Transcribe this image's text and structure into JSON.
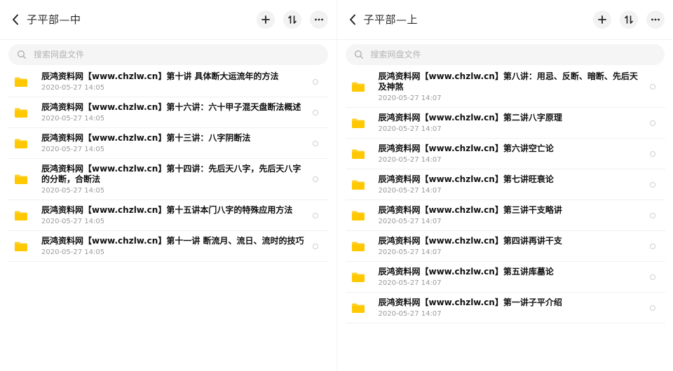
{
  "panes": [
    {
      "title": "子平部—中",
      "search_placeholder": "搜索网盘文件",
      "items": [
        {
          "name": "辰鸿资料网【www.chzlw.cn】第十讲 具体断大运流年的方法",
          "date": "2020-05-27  14:05"
        },
        {
          "name": "辰鸿资料网【www.chzlw.cn】第十六讲：六十甲子混天盘断法概述",
          "date": "2020-05-27  14:05"
        },
        {
          "name": "辰鸿资料网【www.chzlw.cn】第十三讲：八字阴断法",
          "date": "2020-05-27  14:05"
        },
        {
          "name": "辰鸿资料网【www.chzlw.cn】第十四讲：先后天八字，先后天八字的分断，合断法",
          "date": "2020-05-27  14:05"
        },
        {
          "name": "辰鸿资料网【www.chzlw.cn】第十五讲本门八字的特殊应用方法",
          "date": "2020-05-27  14:05"
        },
        {
          "name": "辰鸿资料网【www.chzlw.cn】第十一讲 断流月、流日、流时的技巧",
          "date": "2020-05-27  14:05"
        }
      ]
    },
    {
      "title": "子平部—上",
      "search_placeholder": "搜索网盘文件",
      "items": [
        {
          "name": "辰鸿资料网【www.chzlw.cn】第八讲：用忌、反断、暗断、先后天及神煞",
          "date": "2020-05-27  14:07"
        },
        {
          "name": "辰鸿资料网【www.chzlw.cn】第二讲八字原理",
          "date": "2020-05-27  14:07"
        },
        {
          "name": "辰鸿资料网【www.chzlw.cn】第六讲空亡论",
          "date": "2020-05-27  14:07"
        },
        {
          "name": "辰鸿资料网【www.chzlw.cn】第七讲旺衰论",
          "date": "2020-05-27  14:07"
        },
        {
          "name": "辰鸿资料网【www.chzlw.cn】第三讲干支略讲",
          "date": "2020-05-27  14:07"
        },
        {
          "name": "辰鸿资料网【www.chzlw.cn】第四讲再讲干支",
          "date": "2020-05-27  14:07"
        },
        {
          "name": "辰鸿资料网【www.chzlw.cn】第五讲库墓论",
          "date": "2020-05-27  14:07"
        },
        {
          "name": "辰鸿资料网【www.chzlw.cn】第一讲子平介绍",
          "date": "2020-05-27  14:07"
        }
      ]
    }
  ],
  "icons": {
    "back": "chevron-left-icon",
    "add": "plus-icon",
    "sort": "sort-icon",
    "more": "more-dots-icon",
    "search": "search-icon",
    "folder": "folder-icon"
  },
  "colors": {
    "folder": "#ffd02a",
    "button_bg": "#f2f2f2",
    "search_bg": "#f5f5f5"
  }
}
